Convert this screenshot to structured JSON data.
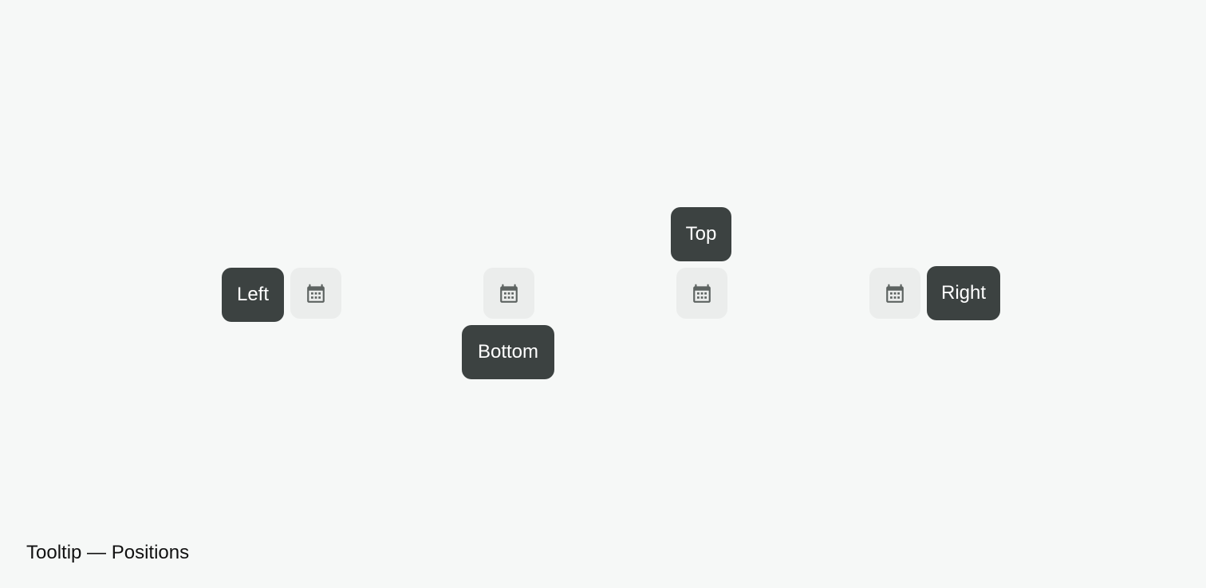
{
  "tooltips": {
    "left": "Left",
    "bottom": "Bottom",
    "top": "Top",
    "right": "Right"
  },
  "icon": "calendar-icon",
  "caption": "Tooltip — Positions",
  "colors": {
    "background": "#f6f8f7",
    "button_bg": "#ebedec",
    "tooltip_bg": "#3c4241",
    "tooltip_text": "#ffffff",
    "icon": "#5d6361"
  }
}
